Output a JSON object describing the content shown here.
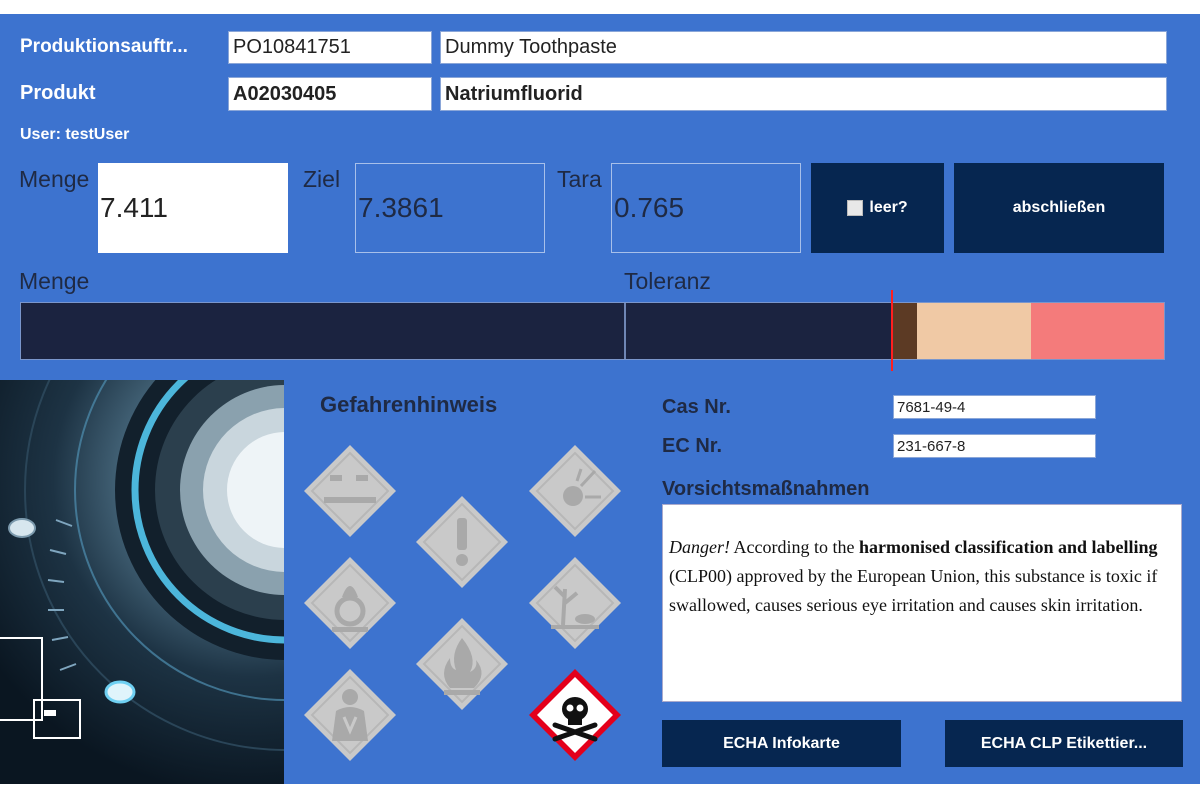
{
  "header": {
    "order_label": "Produktionsauftr...",
    "order_number": "PO10841751",
    "order_description": "Dummy Toothpaste",
    "product_label": "Produkt",
    "product_code": "A02030405",
    "product_name": "Natriumfluorid",
    "user": "User: testUser"
  },
  "weighing": {
    "menge_label": "Menge",
    "menge_value": "7.411",
    "ziel_label": "Ziel",
    "ziel_value": "7.3861",
    "tara_label": "Tara",
    "tara_value": "0.765",
    "empty_checkbox_label": "leer?",
    "empty_checked": false,
    "finish_button": "abschließen"
  },
  "progress": {
    "menge_label": "Menge",
    "toleranz_label": "Toleranz",
    "colors": {
      "filled": "#1b2340",
      "tolerance_low": "#5c3a24",
      "tolerance_mid": "#f0c9a5",
      "over": "#f47b7b",
      "marker": "#ff1f1f"
    }
  },
  "hazards": {
    "title": "Gefahrenhinweis",
    "pictograms": [
      {
        "name": "corrosive",
        "active": false
      },
      {
        "name": "explosive",
        "active": false
      },
      {
        "name": "exclamation",
        "active": false
      },
      {
        "name": "oxidizing",
        "active": false
      },
      {
        "name": "environment",
        "active": false
      },
      {
        "name": "flammable",
        "active": false
      },
      {
        "name": "health-hazard",
        "active": false
      },
      {
        "name": "toxic",
        "active": true
      }
    ],
    "active_color": "#e3001b",
    "inactive_color": "#c9c9c9"
  },
  "identifiers": {
    "cas_label": "Cas Nr.",
    "cas_value": "7681-49-4",
    "ec_label": "EC Nr.",
    "ec_value": "231-667-8"
  },
  "precautions": {
    "title": "Vorsichtsmaßnahmen",
    "text_danger": "Danger!",
    "text_1": " According to the ",
    "text_bold": "harmonised classification and labelling",
    "text_2": " (CLP00) approved by the European Union, this substance is toxic if swallowed, causes serious eye irritation and causes skin irritation."
  },
  "buttons": {
    "echa_info": "ECHA Infokarte",
    "echa_clp": "ECHA CLP Etikettier..."
  }
}
